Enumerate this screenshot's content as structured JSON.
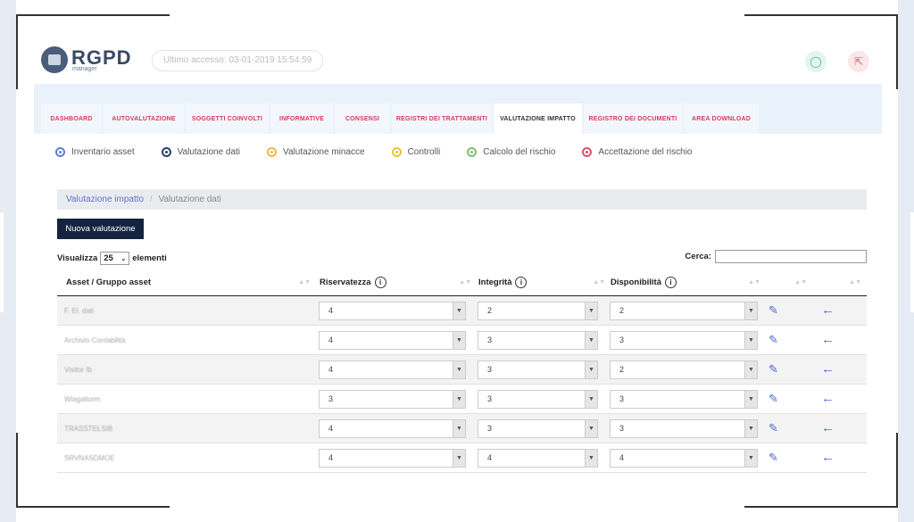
{
  "header": {
    "logo_title": "RGPD",
    "logo_sub": "manager",
    "last_access": "Ultimo accesso: 03-01-2019 15:54:59",
    "user_icon": "user-circle-icon",
    "logout_icon": "logout-icon"
  },
  "tabs": [
    {
      "label": "DASHBOARD"
    },
    {
      "label": "AUTOVALUTAZIONE"
    },
    {
      "label": "SOGGETTI COINVOLTI"
    },
    {
      "label": "INFORMATIVE"
    },
    {
      "label": "CONSENSI"
    },
    {
      "label": "REGISTRI DEI TRATTAMENTI"
    },
    {
      "label": "VALUTAZIONE IMPATTO"
    },
    {
      "label": "REGISTRO DEI DOCUMENTI"
    },
    {
      "label": "AREA DOWNLOAD"
    }
  ],
  "subnav": [
    {
      "label": "Inventario asset",
      "color": "#5b7fd6"
    },
    {
      "label": "Valutazione dati",
      "color": "#2c3e6b"
    },
    {
      "label": "Valutazione minacce",
      "color": "#f0b64a"
    },
    {
      "label": "Controlli",
      "color": "#e8c43a"
    },
    {
      "label": "Calcolo del rischio",
      "color": "#7dc36b"
    },
    {
      "label": "Accettazione del rischio",
      "color": "#e0506a"
    }
  ],
  "breadcrumb": {
    "parent": "Valutazione impatto",
    "separator": "/",
    "current": "Valutazione dati"
  },
  "new_button": "Nuova valutazione",
  "length": {
    "prefix": "Visualizza",
    "value": "25",
    "suffix": "elementi"
  },
  "search": {
    "label": "Cerca:",
    "value": ""
  },
  "table": {
    "columns": [
      "Asset / Gruppo asset",
      "Riservatezza",
      "Integrità",
      "Disponibilità"
    ],
    "rows": [
      {
        "asset": "F. El. dati",
        "riservatezza": "4",
        "integrita": "2",
        "disponibilita": "2"
      },
      {
        "asset": "Archivio Contabilità",
        "riservatezza": "4",
        "integrita": "3",
        "disponibilita": "3"
      },
      {
        "asset": "Visitor Ib",
        "riservatezza": "4",
        "integrita": "3",
        "disponibilita": "2"
      },
      {
        "asset": "Wiagaltorm",
        "riservatezza": "3",
        "integrita": "3",
        "disponibilita": "3"
      },
      {
        "asset": "TRASSTELSIB",
        "riservatezza": "4",
        "integrita": "3",
        "disponibilita": "3"
      },
      {
        "asset": "SRVNASDMOE",
        "riservatezza": "4",
        "integrita": "4",
        "disponibilita": "4"
      }
    ]
  }
}
